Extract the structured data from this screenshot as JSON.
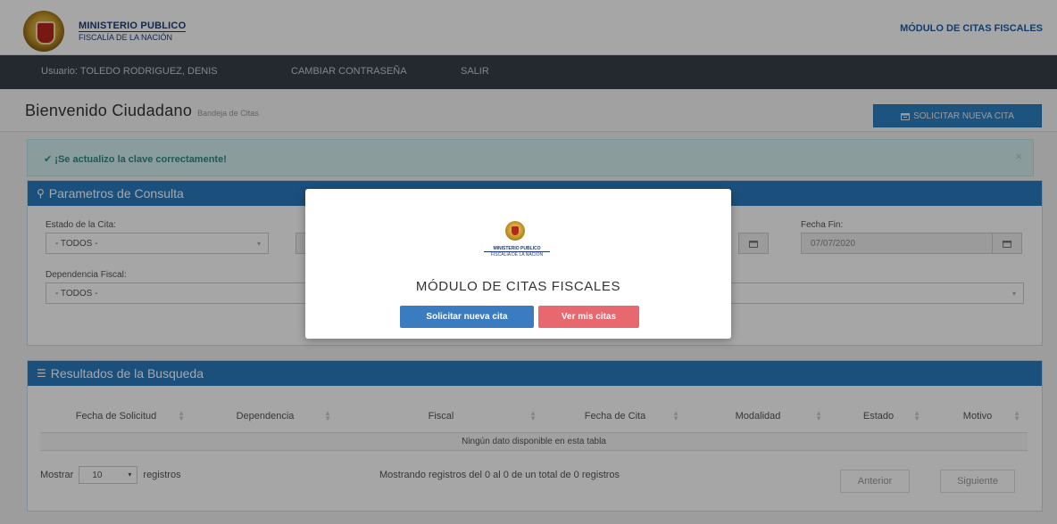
{
  "header": {
    "logo_line1": "MINISTERIO PUBLICO",
    "logo_line2": "FISCALÍA DE LA NACIÓN",
    "module_title": "MÓDULO DE CITAS FISCALES"
  },
  "navbar": {
    "user": "Usuario: TOLEDO RODRIGUEZ, DENIS",
    "change_password": "CAMBIAR CONTRASEÑA",
    "exit": "SALIR"
  },
  "page": {
    "title": "Bienvenido Ciudadano",
    "subtitle": "Bandeja de Citas",
    "new_button": "SOLICITAR NUEVA CITA"
  },
  "alert": {
    "message": "¡Se actualizo la clave correctamente!",
    "close": "×"
  },
  "query_panel": {
    "title": "Parametros de Consulta",
    "estado_label": "Estado de la Cita:",
    "estado_value": "- TODOS -",
    "fecha_fin_label": "Fecha Fin:",
    "fecha_fin_value": "07/07/2020",
    "dependencia_label": "Dependencia Fiscal:",
    "dependencia_value": "- TODOS -"
  },
  "results_panel": {
    "title": "Resultados de la Busqueda",
    "columns": [
      "Fecha de Solicitud",
      "Dependencia",
      "Fiscal",
      "Fecha de Cita",
      "Modalidad",
      "Estado",
      "Motivo"
    ],
    "empty_message": "Ningún dato disponible en esta tabla",
    "show_label": "Mostrar",
    "page_size": "10",
    "records_label": "registros",
    "info": "Mostrando registros del 0 al 0 de un total de 0 registros",
    "prev": "Anterior",
    "next": "Siguiente"
  },
  "modal": {
    "logo_line1": "MINISTERIO PUBLICO",
    "logo_line2": "FISCALÍA DE LA NACIÓN",
    "title": "MÓDULO DE CITAS FISCALES",
    "primary_button": "Solicitar nueva cita",
    "secondary_button": "Ver mis citas"
  },
  "colors": {
    "accent_blue": "#2a7cc1",
    "navbar": "#363f48",
    "modal_primary": "#3b7bbf",
    "modal_secondary": "#e86870"
  }
}
